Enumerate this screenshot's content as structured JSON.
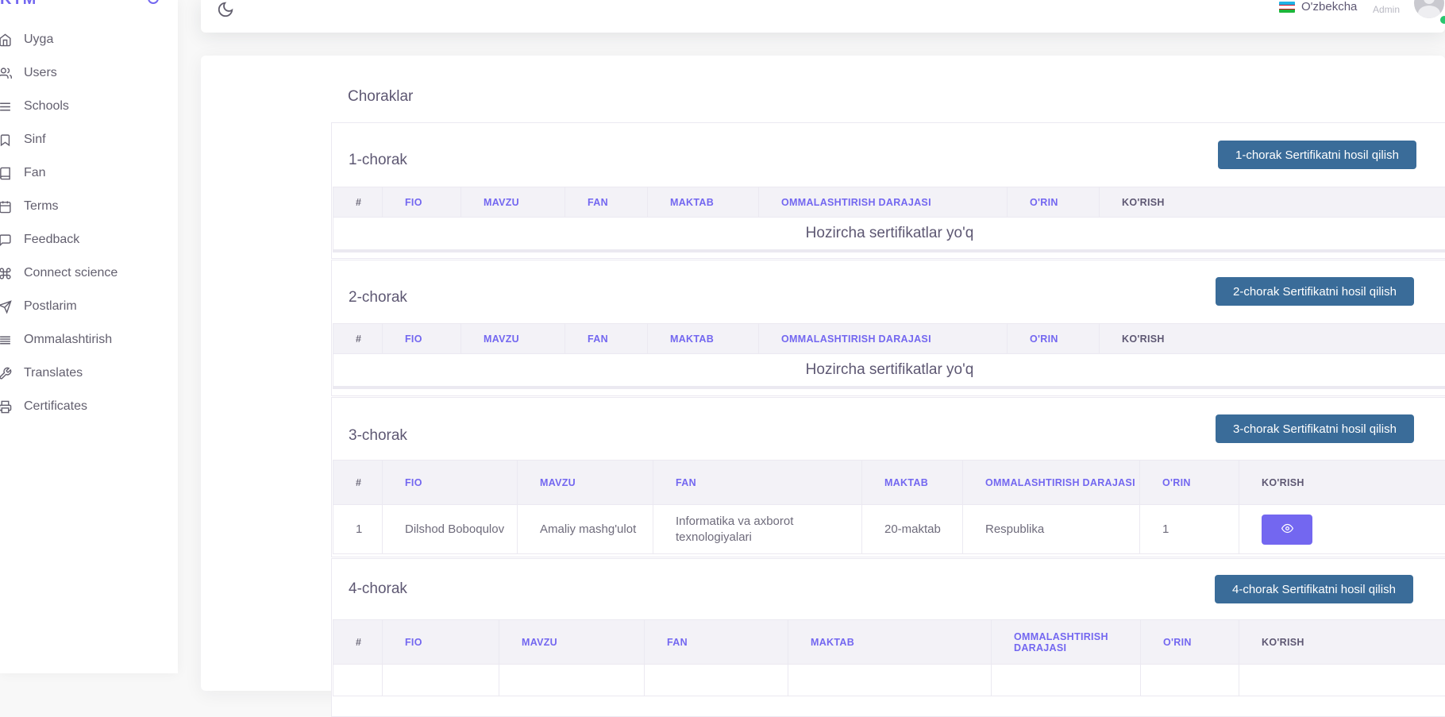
{
  "brand": {
    "name": "KTM"
  },
  "sidebar": {
    "items": [
      {
        "label": "Uyga",
        "icon": "home-icon"
      },
      {
        "label": "Users",
        "icon": "users-icon"
      },
      {
        "label": "Schools",
        "icon": "list-icon"
      },
      {
        "label": "Sinf",
        "icon": "bookmark-icon"
      },
      {
        "label": "Fan",
        "icon": "book-icon"
      },
      {
        "label": "Terms",
        "icon": "calendar-icon"
      },
      {
        "label": "Feedback",
        "icon": "message-square-icon"
      },
      {
        "label": "Connect science",
        "icon": "command-icon"
      },
      {
        "label": "Postlarim",
        "icon": "send-icon"
      },
      {
        "label": "Ommalashtirish",
        "icon": "align-justify-icon"
      },
      {
        "label": "Translates",
        "icon": "tool-icon"
      },
      {
        "label": "Certificates",
        "icon": "printer-icon"
      }
    ]
  },
  "header": {
    "language": "O'zbekcha",
    "role": "Admin"
  },
  "page": {
    "title": "Choraklar",
    "empty_text": "Hozircha sertifikatlar yo'q",
    "columns": [
      "#",
      "FIO",
      "MAVZU",
      "FAN",
      "MAKTAB",
      "OMMALASHTIRISH DARAJASI",
      "O'RIN",
      "KO'RISH"
    ],
    "quarters": [
      {
        "title": "1-chorak",
        "button": "1-chorak Sertifikatni hosil qilish"
      },
      {
        "title": "2-chorak",
        "button": "2-chorak Sertifikatni hosil qilish"
      },
      {
        "title": "3-chorak",
        "button": "3-chorak Sertifikatni hosil qilish",
        "rows": [
          {
            "num": "1",
            "fio": "Dilshod Boboqulov",
            "mavzu": "Amaliy mashg'ulot",
            "fan": "Informatika va axborot texnologiyalari",
            "maktab": "20-maktab",
            "daraja": "Respublika",
            "orin": "1"
          }
        ]
      },
      {
        "title": "4-chorak",
        "button": "4-chorak Sertifikatni hosil qilish"
      }
    ]
  },
  "colors": {
    "accent": "#7367f0",
    "button": "#3a6c99",
    "online": "#28c76f"
  }
}
